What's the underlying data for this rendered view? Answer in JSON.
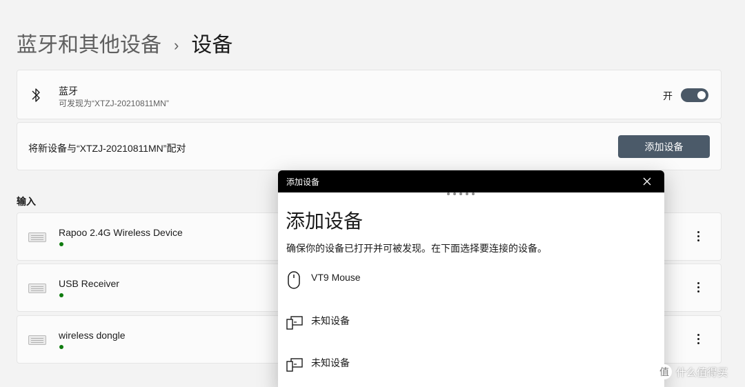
{
  "breadcrumb": {
    "parent": "蓝牙和其他设备",
    "separator": "›",
    "current": "设备"
  },
  "bluetooth": {
    "title": "蓝牙",
    "subtitle": "可发现为“XTZJ-20210811MN”",
    "toggle_label": "开",
    "toggle_on": true
  },
  "pair": {
    "text": "将新设备与“XTZJ-20210811MN”配对",
    "button_label": "添加设备"
  },
  "input_section": {
    "label": "输入"
  },
  "devices": [
    {
      "name": "Rapoo 2.4G Wireless Device",
      "status": "connected",
      "icon": "keyboard-icon"
    },
    {
      "name": "USB Receiver",
      "status": "connected",
      "icon": "keyboard-icon"
    },
    {
      "name": "wireless dongle",
      "status": "connected",
      "icon": "keyboard-icon"
    }
  ],
  "dialog": {
    "window_title": "添加设备",
    "heading": "添加设备",
    "description": "确保你的设备已打开并可被发现。在下面选择要连接的设备。",
    "items": [
      {
        "name": "VT9 Mouse",
        "icon": "mouse-icon"
      },
      {
        "name": "未知设备",
        "icon": "unknown-device-icon"
      },
      {
        "name": "未知设备",
        "icon": "unknown-device-icon"
      }
    ]
  },
  "watermark": {
    "logo": "值",
    "text": "什么值得买"
  },
  "colors": {
    "accent": "#4b5a69",
    "status_green": "#0f7b0f",
    "background": "#f3f3f3"
  }
}
